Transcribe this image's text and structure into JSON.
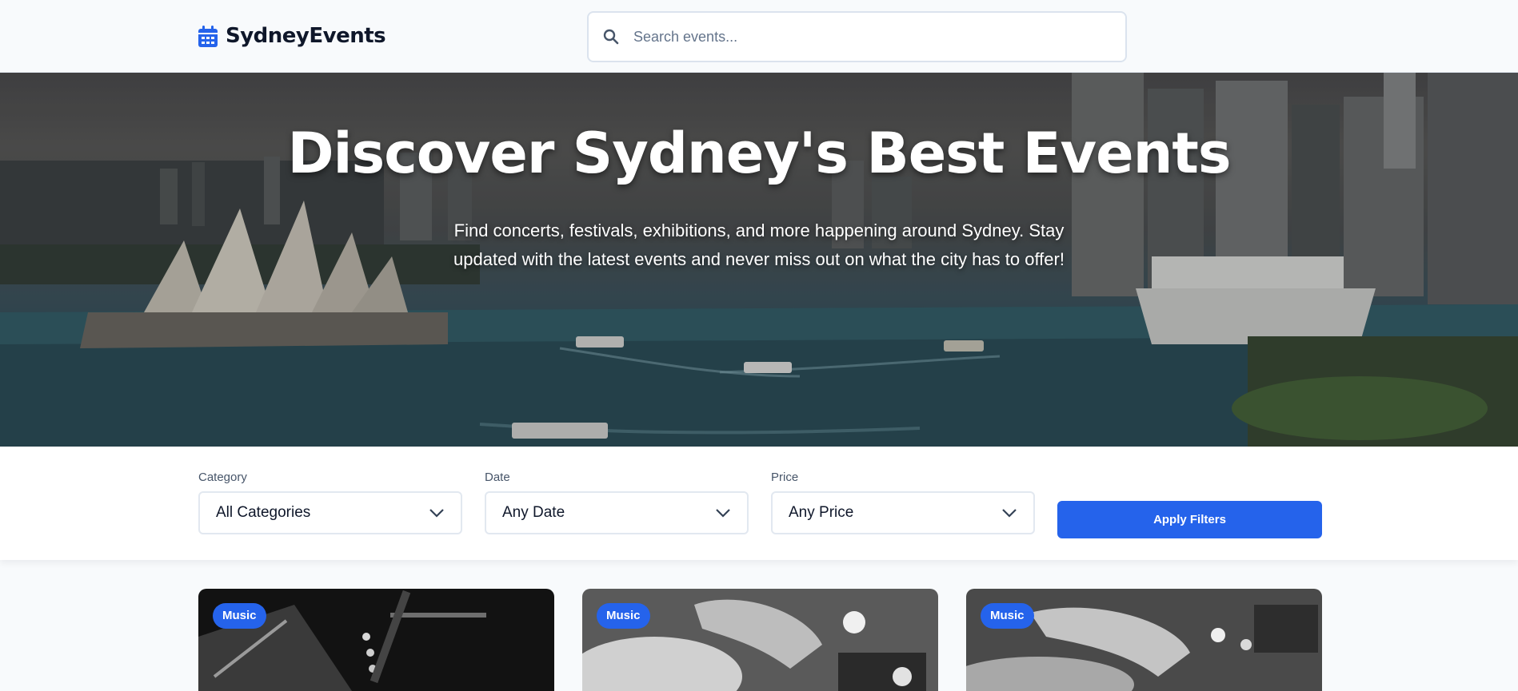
{
  "header": {
    "brand": "SydneyEvents",
    "logo_icon": "calendar-icon",
    "search_placeholder": "Search events...",
    "search_icon": "search-icon"
  },
  "hero": {
    "title": "Discover Sydney's Best Events",
    "subtitle": "Find concerts, festivals, exhibitions, and more happening around Sydney. Stay updated with the latest events and never miss out on what the city has to offer!"
  },
  "filters": {
    "category": {
      "label": "Category",
      "value": "All Categories"
    },
    "date": {
      "label": "Date",
      "value": "Any Date"
    },
    "price": {
      "label": "Price",
      "value": "Any Price"
    },
    "apply_label": "Apply Filters"
  },
  "events": [
    {
      "category": "Music"
    },
    {
      "category": "Music"
    },
    {
      "category": "Music"
    }
  ],
  "colors": {
    "accent": "#2563eb",
    "text": "#0f172a",
    "background": "#f8fafc"
  }
}
